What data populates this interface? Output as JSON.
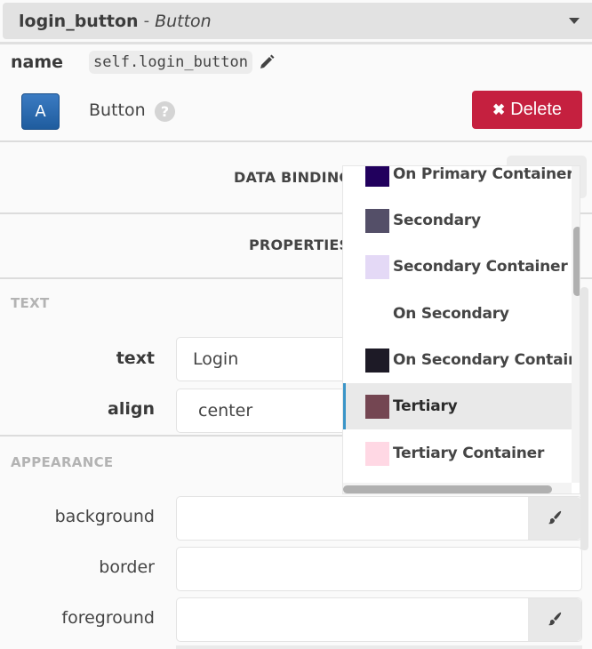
{
  "header": {
    "component_name": "login_button",
    "separator": "-",
    "component_type": "Button"
  },
  "name_row": {
    "label": "name",
    "value": "self.login_button",
    "edit_icon": "pencil-icon"
  },
  "component_row": {
    "icon_letter": "A",
    "type_label": "Button",
    "help_icon_glyph": "?",
    "delete_icon_glyph": "✖",
    "delete_label": "Delete",
    "delete_color": "#c5203f"
  },
  "sections": {
    "data_bindings": "DATA BINDINGS",
    "properties": "PROPERTIES"
  },
  "groups": {
    "text": {
      "title": "TEXT",
      "props": [
        {
          "label": "text",
          "value": "Login"
        },
        {
          "label": "align",
          "value": "center"
        }
      ]
    },
    "appearance": {
      "title": "APPEARANCE",
      "props": [
        {
          "label": "background",
          "value": "",
          "has_color_picker": true
        },
        {
          "label": "border",
          "value": "",
          "has_color_picker": false
        },
        {
          "label": "foreground",
          "value": "",
          "has_color_picker": true
        }
      ]
    }
  },
  "color_dropdown": {
    "selected": "Tertiary",
    "options": [
      {
        "label": "On Primary Container",
        "color": "#21005d"
      },
      {
        "label": "Secondary",
        "color": "#544f68"
      },
      {
        "label": "Secondary Container",
        "color": "#e4d9f6"
      },
      {
        "label": "On Secondary",
        "color": "#ffffff"
      },
      {
        "label": "On Secondary Container",
        "color": "#1d1a26"
      },
      {
        "label": "Tertiary",
        "color": "#744652"
      },
      {
        "label": "Tertiary Container",
        "color": "#ffd8e4"
      }
    ]
  },
  "accent_color": "#3a95c8"
}
